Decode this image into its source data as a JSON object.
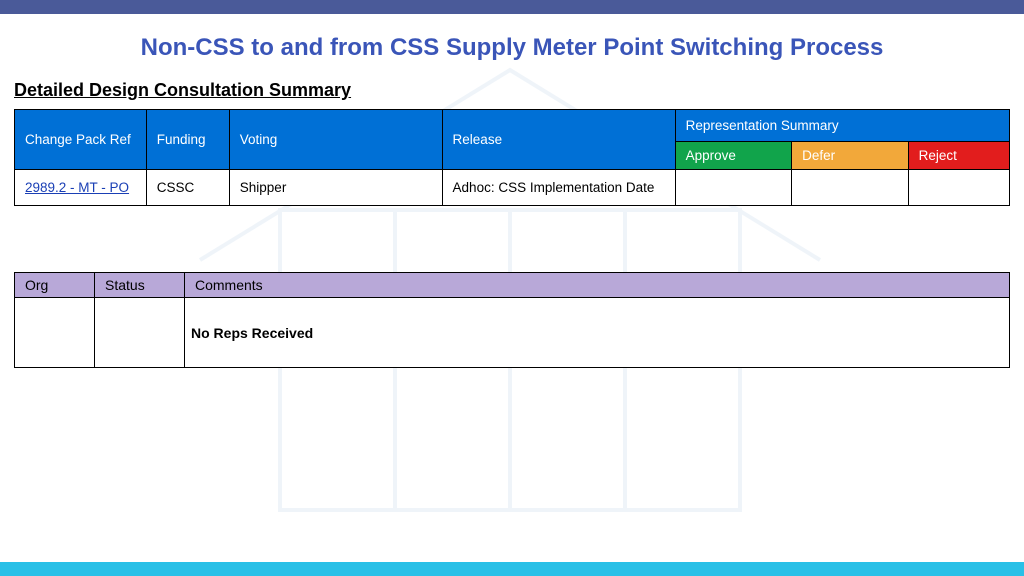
{
  "page": {
    "title": "Non-CSS to and from CSS Supply Meter Point Switching Process",
    "section_heading": "Detailed Design Consultation Summary"
  },
  "table1": {
    "headers": {
      "change_pack_ref": "Change Pack Ref",
      "funding": "Funding",
      "voting": "Voting",
      "release": "Release",
      "rep_summary": "Representation Summary",
      "approve": "Approve",
      "defer": "Defer",
      "reject": "Reject"
    },
    "row": {
      "change_pack_ref": "2989.2 - MT - PO",
      "funding": "CSSC",
      "voting": "Shipper",
      "release": "Adhoc: CSS Implementation Date",
      "approve": "",
      "defer": "",
      "reject": ""
    }
  },
  "table2": {
    "headers": {
      "org": "Org",
      "status": "Status",
      "comments": "Comments"
    },
    "row": {
      "org": "",
      "status": "",
      "comments": "No Reps Received"
    }
  },
  "colors": {
    "top_bar": "#4a5a99",
    "bottom_bar": "#29c0e7",
    "title": "#3a55b8",
    "hdr_blue": "#0070d6",
    "hdr_green": "#11a44b",
    "hdr_orange": "#f2a83a",
    "hdr_red": "#e21d1d",
    "tbl2_header": "#b8a8d8"
  }
}
